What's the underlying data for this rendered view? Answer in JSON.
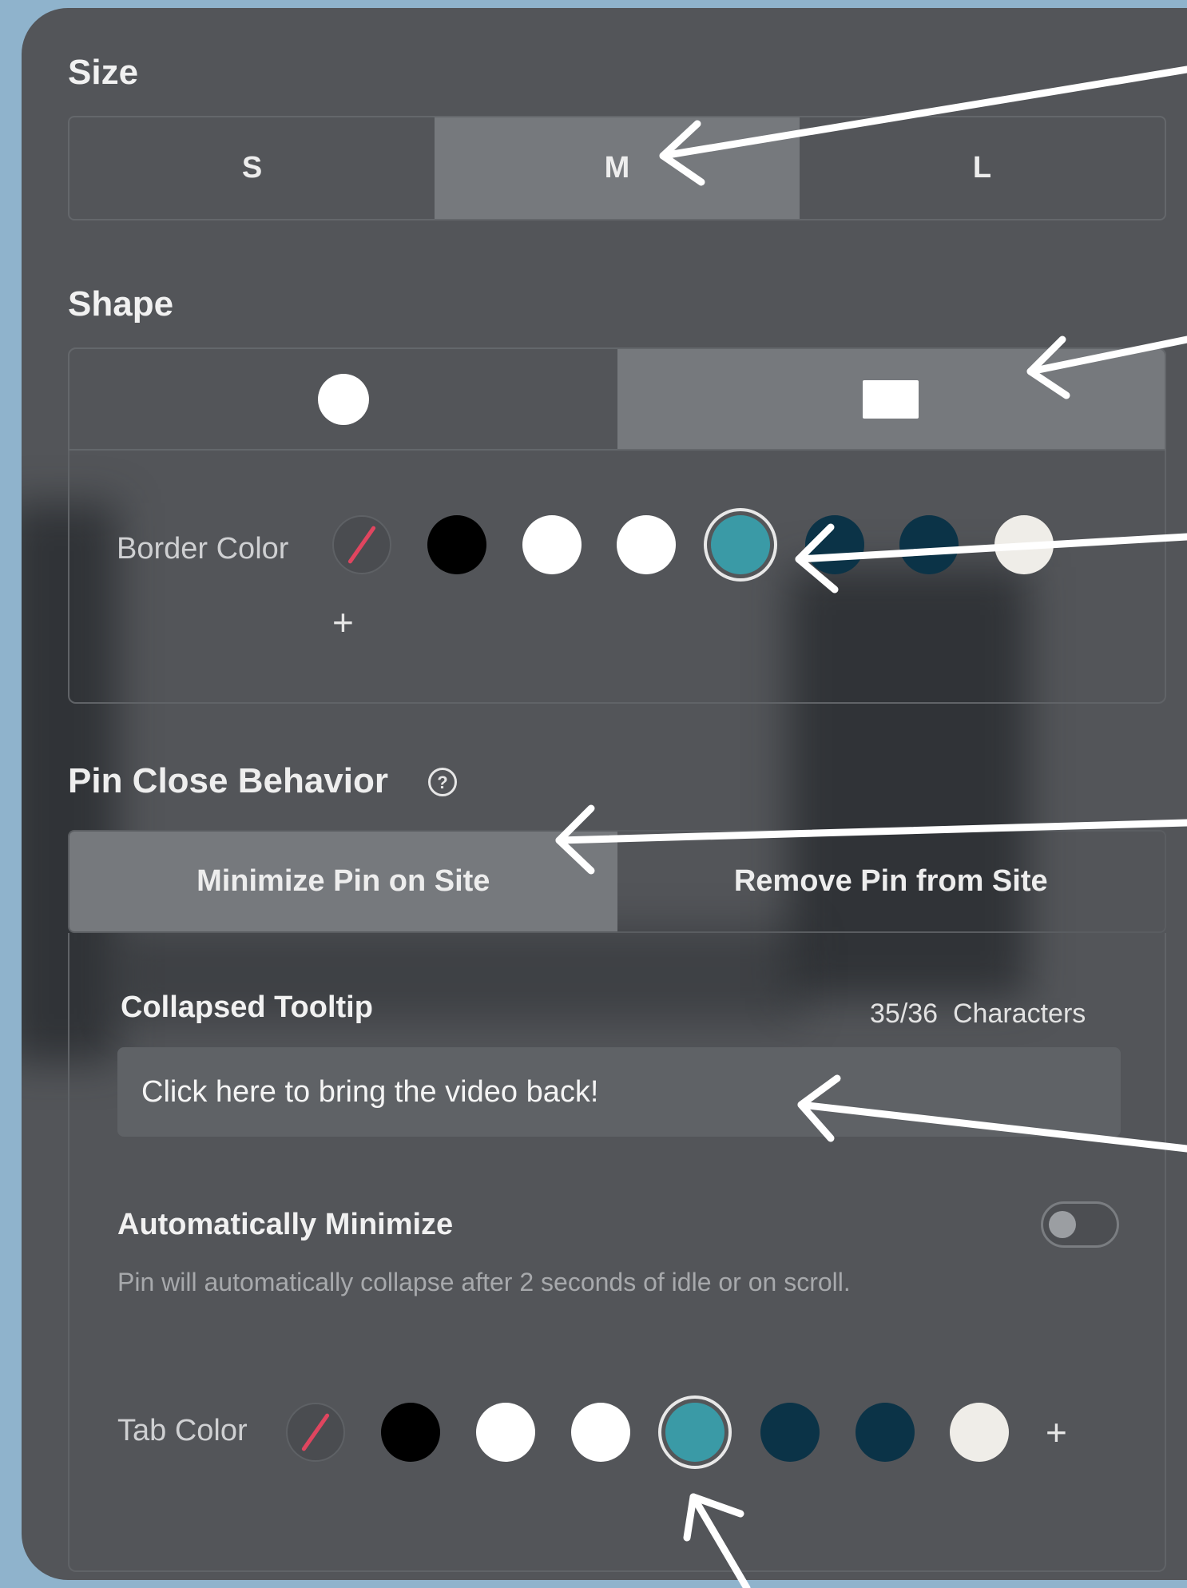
{
  "size": {
    "label": "Size",
    "options": [
      "S",
      "M",
      "L"
    ],
    "selected": "M"
  },
  "shape": {
    "label": "Shape",
    "options": [
      {
        "name": "circle",
        "icon": "circle-shape-icon"
      },
      {
        "name": "rectangle",
        "icon": "rectangle-shape-icon"
      }
    ],
    "selected": "rectangle",
    "border_color": {
      "label": "Border Color",
      "swatches": [
        "none",
        "#000000",
        "#ffffff",
        "#ffffff",
        "#3a9aa6",
        "#0b3347",
        "#0b3347",
        "#efede8"
      ],
      "selected_index": 4,
      "add_icon": "+"
    }
  },
  "pin_close": {
    "label": "Pin Close Behavior",
    "help_icon": "?",
    "options": [
      "Minimize Pin on Site",
      "Remove Pin from Site"
    ],
    "selected": "Minimize Pin on Site"
  },
  "tooltip": {
    "label": "Collapsed Tooltip",
    "count": "35/36",
    "count_unit": "Characters",
    "value": "Click here to bring the video back!"
  },
  "auto_minimize": {
    "label": "Automatically Minimize",
    "description": "Pin will automatically collapse after 2 seconds of idle or on scroll.",
    "enabled": false
  },
  "tab_color": {
    "label": "Tab Color",
    "swatches": [
      "none",
      "#000000",
      "#ffffff",
      "#ffffff",
      "#3a9aa6",
      "#0b3347",
      "#0b3347",
      "#efede8"
    ],
    "selected_index": 4,
    "add_icon": "+"
  },
  "colors": {
    "background": "#8fb3cc",
    "panel": "#535559",
    "selected_segment": "#76797d",
    "accent_teal": "#3a9aa6"
  }
}
